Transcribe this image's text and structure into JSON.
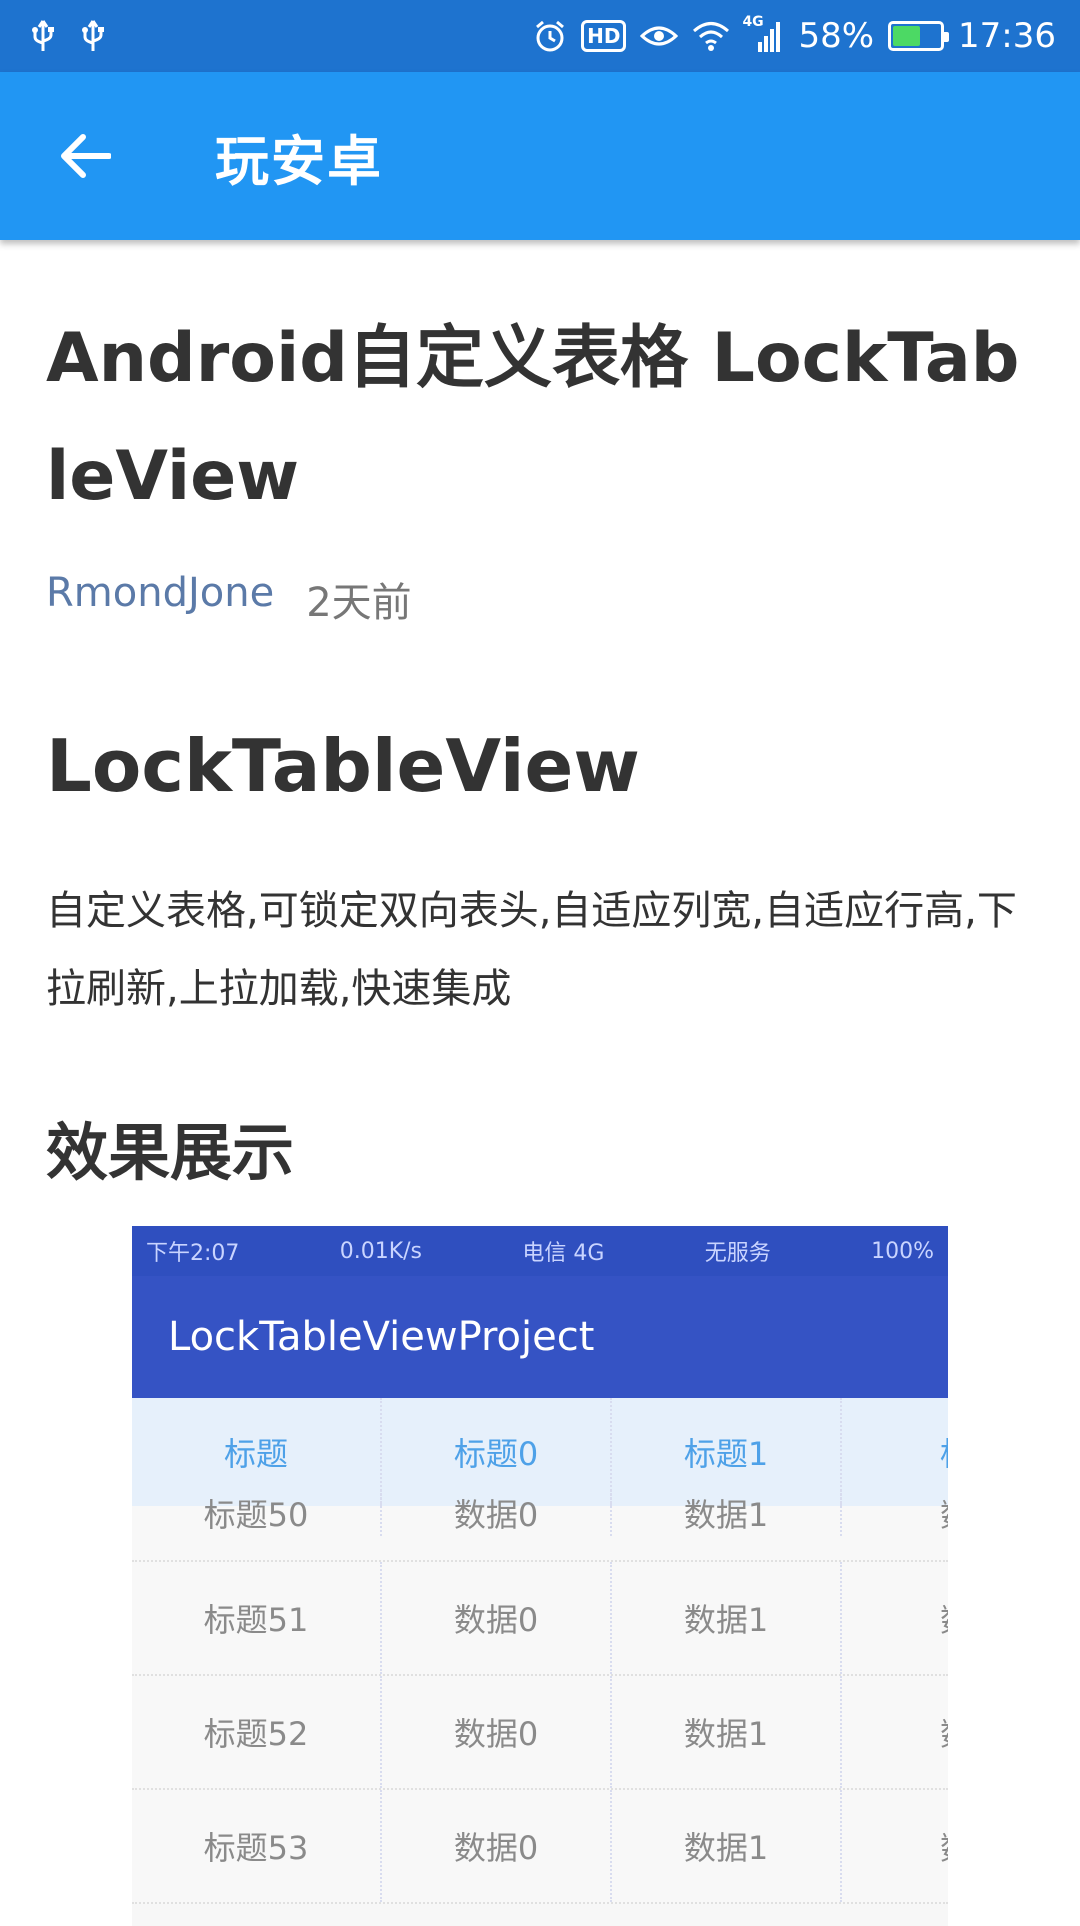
{
  "status_bar": {
    "battery_percent": "58%",
    "battery_level": 0.58,
    "time": "17:36",
    "hd_label": "HD",
    "network_label": "4G"
  },
  "toolbar": {
    "title": "玩安卓"
  },
  "article": {
    "title": "Android自定义表格 LockTableView",
    "author": "RmondJone",
    "time": "2天前",
    "heading1": "LockTableView",
    "description": "自定义表格,可锁定双向表头,自适应列宽,自适应行高,下拉刷新,上拉加载,快速集成",
    "heading2": "效果展示"
  },
  "demo_image": {
    "status_left": "下午2:07",
    "status_mid": "0.01K/s",
    "status_carrier": "电信 4G",
    "status_service": "无服务",
    "status_battery": "100%",
    "app_title": "LockTableViewProject",
    "headers": [
      "标题",
      "标题0",
      "标题1",
      "标"
    ],
    "rows": [
      [
        "标题50",
        "数据0",
        "数据1",
        "数"
      ],
      [
        "标题51",
        "数据0",
        "数据1",
        "数"
      ],
      [
        "标题52",
        "数据0",
        "数据1",
        "数"
      ],
      [
        "标题53",
        "数据0",
        "数据1",
        "数"
      ]
    ]
  }
}
